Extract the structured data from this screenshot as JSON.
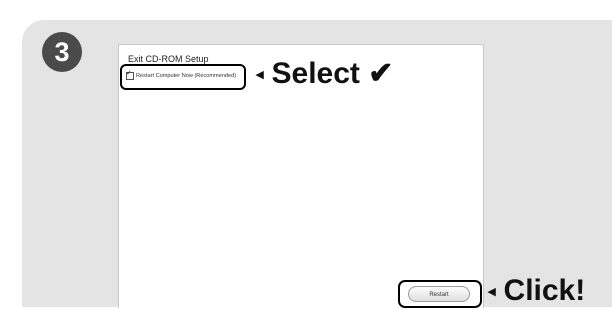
{
  "step": {
    "number": "3"
  },
  "window": {
    "title": "Exit CD-ROM Setup",
    "option": {
      "label": "Restart Computer Now (Recommended)",
      "checked": true,
      "check_glyph": "☑"
    },
    "restart_button_label": "Restart"
  },
  "callouts": {
    "arrow_glyph": "◂",
    "select_text": "Select ✔",
    "click_text": "Click!"
  },
  "colors": {
    "panel_bg": "#e4e4e4",
    "badge_bg": "#4a4a4a",
    "window_bg": "#ffffff",
    "highlight_border": "#000000"
  }
}
